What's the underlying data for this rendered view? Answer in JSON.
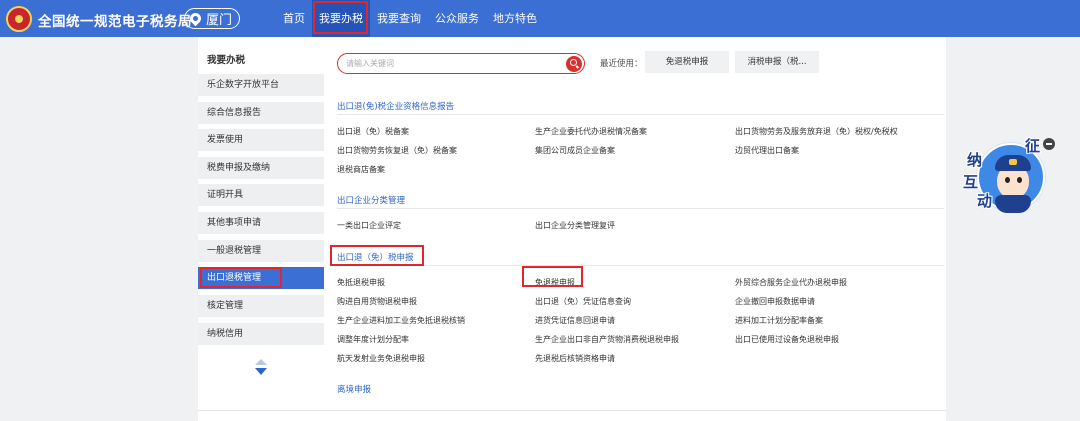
{
  "header": {
    "site_title": "全国统一规范电子税务局",
    "city": "厦门",
    "nav": [
      "首页",
      "我要办税",
      "我要查询",
      "公众服务",
      "地方特色"
    ]
  },
  "sidebar": {
    "heading": "我要办税",
    "items": [
      "乐企数字开放平台",
      "综合信息报告",
      "发票使用",
      "税费申报及缴纳",
      "证明开具",
      "其他事项申请",
      "一般退税管理",
      "出口退税管理",
      "核定管理",
      "纳税信用"
    ],
    "active_index": 7
  },
  "search": {
    "placeholder": "请输入关键词",
    "recent_label": "最近使用：",
    "recent": [
      "免退税申报",
      "消税申报（税..."
    ]
  },
  "sections": [
    {
      "title": "出口退(免)税企业资格信息报告",
      "links": [
        "出口退（免）税备案",
        "生产企业委托代办退税情况备案",
        "出口货物劳务及服务放弃退（免）税权/免税权",
        "出口货物劳务恢复退（免）税备案",
        "集团公司成员企业备案",
        "边贸代理出口备案",
        "退税商店备案"
      ]
    },
    {
      "title": "出口企业分类管理",
      "links": [
        "一类出口企业评定",
        "出口企业分类管理复评"
      ]
    },
    {
      "title": "出口退（免）税申报",
      "links": [
        "免抵退税申报",
        "免退税申报",
        "外贸综合服务企业代办退税申报",
        "购进自用货物退税申报",
        "出口退（免）凭证信息查询",
        "企业撤回申报数据申请",
        "生产企业进料加工业务免抵退税核销",
        "进货凭证信息回退申请",
        "进料加工计划分配率备案",
        "调整年度计划分配率",
        "生产企业出口非自产货物消费税退税申报",
        "出口已使用过设备免退税申报",
        "航天发射业务免退税申报",
        "先退税后核销资格申请"
      ]
    },
    {
      "title": "离境申报",
      "links": []
    }
  ],
  "widget": {
    "chars": [
      "征",
      "纳",
      "互",
      "动"
    ]
  },
  "colors": {
    "header_blue": "#3b6fd4",
    "active_blue": "#2553b6",
    "section_blue": "#2f65c9",
    "highlight_red": "#e2262b"
  }
}
